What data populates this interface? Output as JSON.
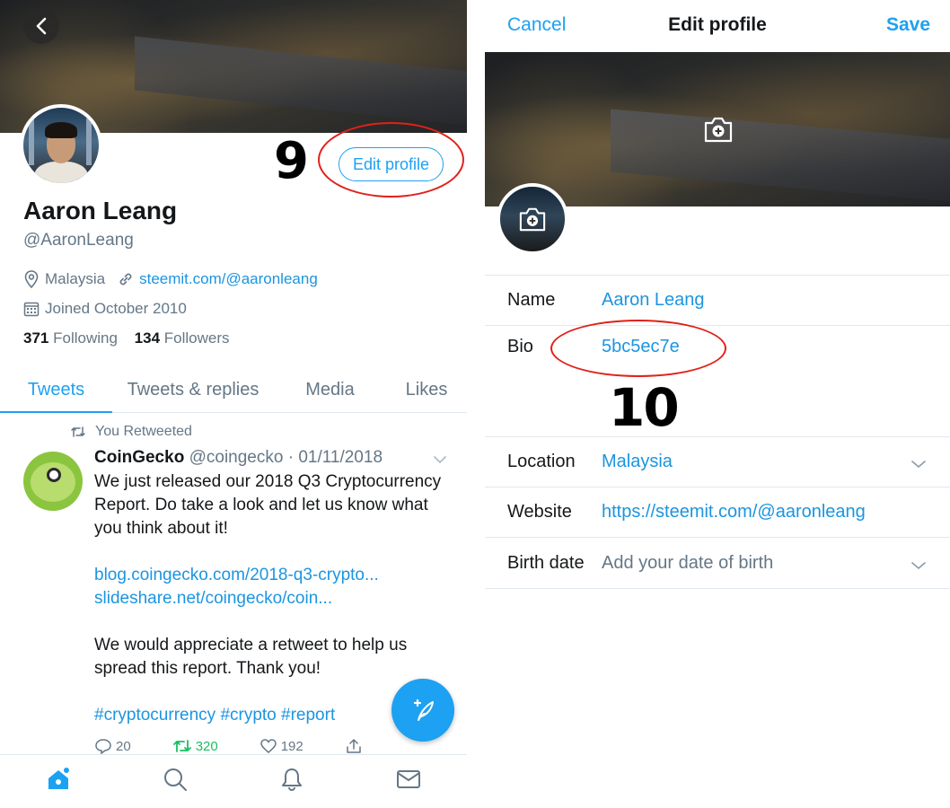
{
  "left": {
    "profile": {
      "name": "Aaron Leang",
      "handle": "@AaronLeang",
      "location": "Malaysia",
      "website": "steemit.com/@aaronleang",
      "joined": "Joined October 2010",
      "following_count": "371",
      "following_label": "Following",
      "followers_count": "134",
      "followers_label": "Followers",
      "edit_button": "Edit profile"
    },
    "annotation": "9",
    "tabs": [
      "Tweets",
      "Tweets & replies",
      "Media",
      "Likes"
    ],
    "tweet": {
      "retweet_note": "You Retweeted",
      "author": "CoinGecko",
      "handle": "@coingecko",
      "date": "01/11/2018",
      "text1": "We just released our 2018 Q3 Cryptocurrency Report. Do take a look and let us know what you think about it!",
      "link1": "blog.coingecko.com/2018-q3-crypto...",
      "link2": "slideshare.net/coingecko/coin...",
      "text2": "We would appreciate a retweet to help us spread this report. Thank you!",
      "hashtags": "#cryptocurrency #crypto #report",
      "replies": "20",
      "retweets": "320",
      "likes": "192"
    },
    "nav_icons": [
      "home-icon",
      "search-icon",
      "bell-icon",
      "mail-icon"
    ]
  },
  "right": {
    "cancel": "Cancel",
    "title": "Edit profile",
    "save": "Save",
    "annotation": "10",
    "fields": {
      "name_label": "Name",
      "name_value": "Aaron Leang",
      "bio_label": "Bio",
      "bio_value": "5bc5ec7e",
      "location_label": "Location",
      "location_value": "Malaysia",
      "website_label": "Website",
      "website_value": "https://steemit.com/@aaronleang",
      "birth_label": "Birth date",
      "birth_placeholder": "Add your date of birth"
    }
  },
  "colors": {
    "accent": "#1da1f2",
    "link": "#1b95e0",
    "secondary_text": "#657786",
    "retweet_green": "#17bf63",
    "annotation_red": "#e0211b"
  }
}
